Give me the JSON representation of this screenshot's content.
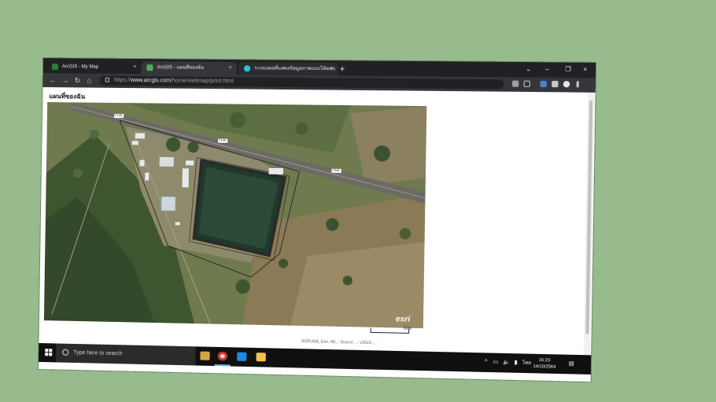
{
  "browser": {
    "tabs": [
      {
        "label": "ArcGIS - My Map",
        "close": "×"
      },
      {
        "label": "ArcGIS - แผนที่ของฉัน",
        "close": "×"
      },
      {
        "label": "ระบบแผนที่แสดงข้อมูลภาพแบบโต้ตอบ",
        "close": "×"
      }
    ],
    "new_tab": "+",
    "window_controls": {
      "dropdown": "⌄",
      "minimize": "–",
      "maximize": "❐",
      "close": "×"
    },
    "nav": {
      "back": "←",
      "forward": "→",
      "reload": "↻",
      "home": "⌂"
    },
    "url": {
      "scheme": "https://",
      "host": "www.arcgis.com",
      "path": "/home/webmap/print.html"
    }
  },
  "page": {
    "title": "แผนที่ของฉัน",
    "scale_label": "60m",
    "esri_logo": "esri",
    "footer": "ROPUNA, Esri, HE... Source: ... USGS, ...",
    "road_labels": [
      "2148",
      "2148",
      "2348"
    ]
  },
  "taskbar": {
    "search_placeholder": "Type here to search",
    "tray": {
      "chevron": "^",
      "network": "▭",
      "volume": "🔈",
      "wifi": "▮",
      "lang": "ไทย"
    },
    "time": "16:23",
    "date": "14/10/2564",
    "notification": "▤"
  },
  "colors": {
    "tab_strip": "#202124",
    "toolbar": "#35363a",
    "pond": "#2d4a38",
    "road": "#6c6a64",
    "background": "#97bb8c"
  }
}
